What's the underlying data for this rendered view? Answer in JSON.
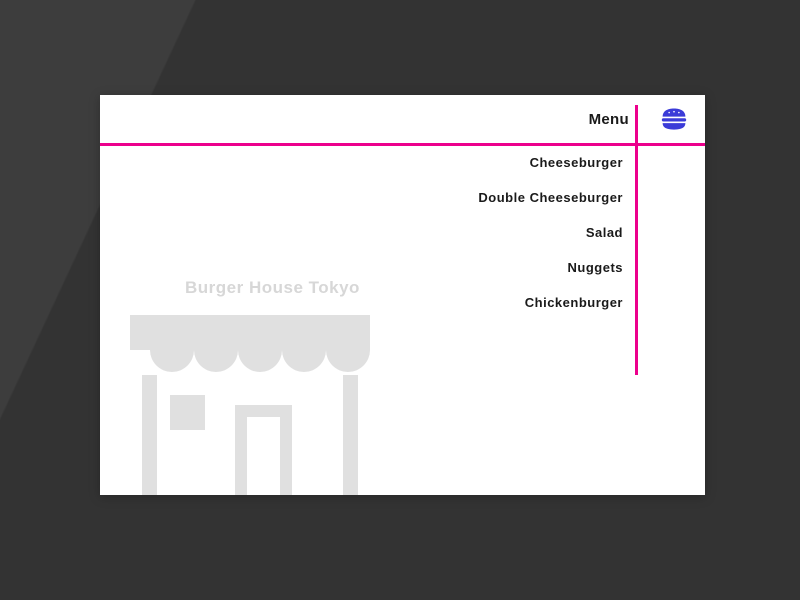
{
  "colors": {
    "accent_pink": "#ec008c",
    "icon_indigo": "#3b3bd8",
    "muted_gray": "#d7d7d7"
  },
  "header": {
    "title": "Menu",
    "icon": "burger-icon"
  },
  "menu": {
    "items": [
      {
        "label": "Cheeseburger"
      },
      {
        "label": "Double Cheeseburger"
      },
      {
        "label": "Salad"
      },
      {
        "label": "Nuggets"
      },
      {
        "label": "Chickenburger"
      }
    ]
  },
  "store": {
    "name": "Burger House Tokyo",
    "icon": "storefront-icon"
  }
}
